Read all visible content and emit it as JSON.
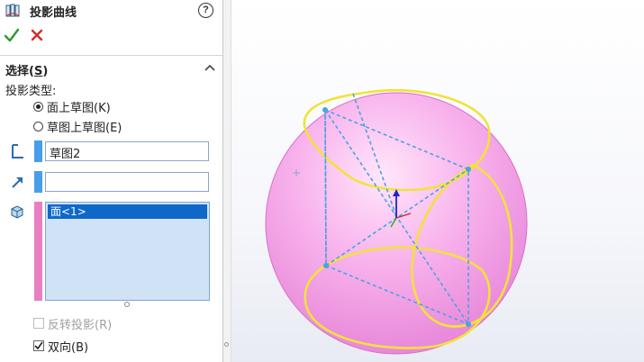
{
  "header": {
    "title": "投影曲线",
    "help_glyph": "?"
  },
  "actions": {
    "ok_icon": "checkmark-icon",
    "cancel_icon": "x-icon"
  },
  "selection": {
    "group_title_prefix": "选择(",
    "group_title_key": "S",
    "group_title_suffix": ")",
    "type_label": "投影类型:",
    "options": [
      {
        "label": "面上草图(K)",
        "selected": true
      },
      {
        "label": "草图上草图(E)",
        "selected": false
      }
    ],
    "sketch_field_value": "草图2",
    "direction_field_value": "",
    "faces_list": [
      "面<1>"
    ]
  },
  "checkboxes": {
    "reverse": {
      "label": "反转投影(R)",
      "checked": false,
      "enabled": false
    },
    "bidirectional": {
      "label": "双向(B)",
      "checked": true,
      "enabled": true
    }
  },
  "colors": {
    "accent_blue": "#4a9de8",
    "face_pink": "#e97fc3",
    "sphere_pink": "#f7a8e6",
    "curve_yellow": "#f2e23a",
    "sketch_dash": "#4aa3e0"
  }
}
